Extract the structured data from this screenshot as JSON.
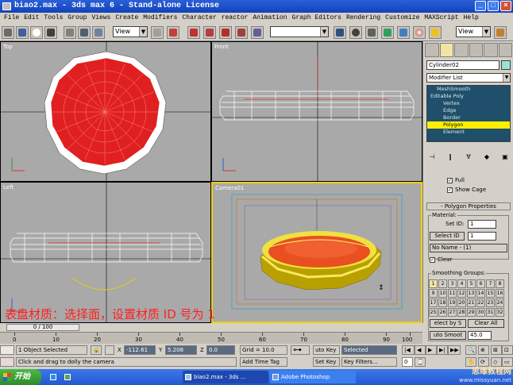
{
  "window": {
    "title": "biao2.max - 3ds max 6 - Stand-alone License",
    "controls": [
      "minimize-icon",
      "maximize-icon",
      "close-icon"
    ]
  },
  "menu": [
    "File",
    "Edit",
    "Tools",
    "Group",
    "Views",
    "Create",
    "Modifiers",
    "Character",
    "reactor",
    "Animation",
    "Graph Editors",
    "Rendering",
    "Customize",
    "MAXScript",
    "Help"
  ],
  "toolbar": {
    "reference_coord": "View",
    "named_selection": "",
    "view_dropdown": "View"
  },
  "viewports": {
    "top_label": "Top",
    "front_label": "Front",
    "left_label": "Left",
    "camera_label": "Camera01",
    "caption": "表盘材质：选择面，设置材质 ID 号为 1"
  },
  "command_panel": {
    "object_name": "Cylinder02",
    "object_color": "#9ee0d8",
    "modifier_list": "Modifier List",
    "stack": [
      {
        "label": "MeshSmooth",
        "indent": 1,
        "selected": false
      },
      {
        "label": "Editable Poly",
        "indent": 0,
        "selected": false
      },
      {
        "label": "Vertex",
        "indent": 2,
        "selected": false
      },
      {
        "label": "Edge",
        "indent": 2,
        "selected": false
      },
      {
        "label": "Border",
        "indent": 2,
        "selected": false
      },
      {
        "label": "Polygon",
        "indent": 2,
        "selected": true
      },
      {
        "label": "Element",
        "indent": 2,
        "selected": false
      }
    ],
    "full_label": "Full",
    "show_cage_label": "Show Cage",
    "rollout_title": "- Polygon Properties",
    "material_group": "Material:",
    "set_id_label": "Set ID:",
    "set_id_value": "1",
    "select_id_label": "Select ID",
    "select_id_value": "1",
    "no_name_option": "No Name - (1)",
    "clear_label": "Clear",
    "smoothing_group": "Smoothing Groups:",
    "smoothing_numbers": [
      "1",
      "2",
      "3",
      "4",
      "5",
      "6",
      "7",
      "8",
      "9",
      "10",
      "11",
      "12",
      "13",
      "14",
      "15",
      "16",
      "17",
      "18",
      "19",
      "20",
      "21",
      "22",
      "23",
      "24",
      "25",
      "26",
      "27",
      "28",
      "29",
      "30",
      "31",
      "32"
    ],
    "smoothing_active": "1",
    "select_by_sg": "elect by S",
    "clear_all": "Clear All",
    "auto_smooth": "uto Smoot",
    "auto_smooth_value": "45.0"
  },
  "timeline": {
    "frame_display": "0 / 100",
    "ticks": [
      "0",
      "10",
      "20",
      "30",
      "40",
      "50",
      "60",
      "70",
      "80",
      "90",
      "100"
    ]
  },
  "status": {
    "selection": "1 Object Selected",
    "prompt": "Click and drag to dolly the camera",
    "x_label": "X",
    "x_value": "-112.61",
    "y_label": "Y",
    "y_value": "5.208",
    "z_label": "Z",
    "z_value": "0.0",
    "grid": "Grid = 10.0",
    "add_time_tag": "Add Time Tag",
    "auto_key": "uto Key",
    "set_key": "Set Key",
    "selected_dropdown": "Selected",
    "key_filters": "Key Filters...",
    "frame_field": "0"
  },
  "taskbar": {
    "start": "开始",
    "tasks": [
      "biao2.max - 3ds ...",
      "Adobe Photoshop"
    ],
    "watermark_line1": "思缘教程网",
    "watermark_line2": "www.missyuan.net"
  }
}
